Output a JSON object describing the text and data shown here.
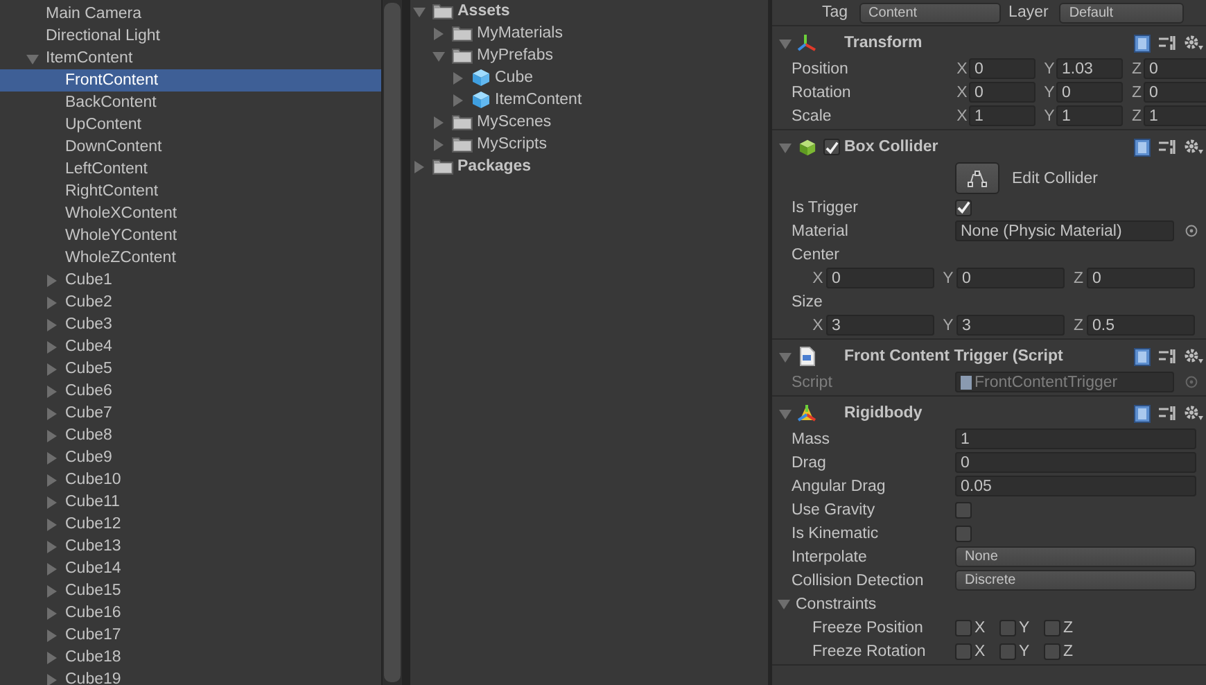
{
  "hierarchy": {
    "items": [
      {
        "name": "Main Camera",
        "selected": false
      },
      {
        "name": "Directional Light",
        "selected": false
      },
      {
        "name": "ItemContent",
        "selected": false,
        "expanded": true,
        "children": [
          {
            "name": "FrontContent",
            "selected": true
          },
          {
            "name": "BackContent",
            "selected": false
          },
          {
            "name": "UpContent",
            "selected": false
          },
          {
            "name": "DownContent",
            "selected": false
          },
          {
            "name": "LeftContent",
            "selected": false
          },
          {
            "name": "RightContent",
            "selected": false
          },
          {
            "name": "WholeXContent",
            "selected": false
          },
          {
            "name": "WholeYContent",
            "selected": false
          },
          {
            "name": "WholeZContent",
            "selected": false
          },
          {
            "name": "Cube1",
            "selected": false,
            "expanded": false
          },
          {
            "name": "Cube2",
            "selected": false,
            "expanded": false
          },
          {
            "name": "Cube3",
            "selected": false,
            "expanded": false
          },
          {
            "name": "Cube4",
            "selected": false,
            "expanded": false
          },
          {
            "name": "Cube5",
            "selected": false,
            "expanded": false
          },
          {
            "name": "Cube6",
            "selected": false,
            "expanded": false
          },
          {
            "name": "Cube7",
            "selected": false,
            "expanded": false
          },
          {
            "name": "Cube8",
            "selected": false,
            "expanded": false
          },
          {
            "name": "Cube9",
            "selected": false,
            "expanded": false
          },
          {
            "name": "Cube10",
            "selected": false,
            "expanded": false
          },
          {
            "name": "Cube11",
            "selected": false,
            "expanded": false
          },
          {
            "name": "Cube12",
            "selected": false,
            "expanded": false
          },
          {
            "name": "Cube13",
            "selected": false,
            "expanded": false
          },
          {
            "name": "Cube14",
            "selected": false,
            "expanded": false
          },
          {
            "name": "Cube15",
            "selected": false,
            "expanded": false
          },
          {
            "name": "Cube16",
            "selected": false,
            "expanded": false
          },
          {
            "name": "Cube17",
            "selected": false,
            "expanded": false
          },
          {
            "name": "Cube18",
            "selected": false,
            "expanded": false
          },
          {
            "name": "Cube19",
            "selected": false,
            "expanded": false
          }
        ]
      }
    ]
  },
  "project": {
    "items": [
      {
        "name": "Assets",
        "kind": "root",
        "expanded": true,
        "children": [
          {
            "name": "MyMaterials",
            "kind": "folder",
            "expanded": false
          },
          {
            "name": "MyPrefabs",
            "kind": "folder",
            "expanded": true,
            "children": [
              {
                "name": "Cube",
                "kind": "prefab",
                "expanded": false
              },
              {
                "name": "ItemContent",
                "kind": "prefab",
                "expanded": false
              }
            ]
          },
          {
            "name": "MyScenes",
            "kind": "folder",
            "expanded": false
          },
          {
            "name": "MyScripts",
            "kind": "folder",
            "expanded": false
          }
        ]
      },
      {
        "name": "Packages",
        "kind": "root",
        "expanded": false
      }
    ]
  },
  "inspector": {
    "tag_label": "Tag",
    "tag": "Content",
    "layer_label": "Layer",
    "layer": "Default",
    "components": [
      {
        "title": "Transform",
        "kind": "transform",
        "expanded": true,
        "rows": [
          {
            "kind": "vector",
            "label": "Position",
            "axes": [
              {
                "axis": "X",
                "value": "0"
              },
              {
                "axis": "Y",
                "value": "1.03"
              },
              {
                "axis": "Z",
                "value": "0"
              }
            ]
          },
          {
            "kind": "vector",
            "label": "Rotation",
            "axes": [
              {
                "axis": "X",
                "value": "0"
              },
              {
                "axis": "Y",
                "value": "0"
              },
              {
                "axis": "Z",
                "value": "0"
              }
            ]
          },
          {
            "kind": "vector",
            "label": "Scale",
            "axes": [
              {
                "axis": "X",
                "value": "1"
              },
              {
                "axis": "Y",
                "value": "1"
              },
              {
                "axis": "Z",
                "value": "1"
              }
            ]
          }
        ]
      },
      {
        "title": "Box Collider",
        "kind": "collider",
        "expanded": true,
        "enabled": true,
        "rows": [
          {
            "kind": "tool",
            "label": "Edit Collider"
          },
          {
            "kind": "toggle",
            "label": "Is Trigger",
            "checked": true
          },
          {
            "kind": "object",
            "label": "Material",
            "value": "None (Physic Material)"
          },
          {
            "kind": "vector_block",
            "label": "Center",
            "axes": [
              {
                "axis": "X",
                "value": "0"
              },
              {
                "axis": "Y",
                "value": "0"
              },
              {
                "axis": "Z",
                "value": "0"
              }
            ]
          },
          {
            "kind": "vector_block",
            "label": "Size",
            "axes": [
              {
                "axis": "X",
                "value": "3"
              },
              {
                "axis": "Y",
                "value": "3"
              },
              {
                "axis": "Z",
                "value": "0.5"
              }
            ]
          }
        ]
      },
      {
        "title": "Front Content Trigger (Script",
        "kind": "script",
        "expanded": true,
        "rows": [
          {
            "kind": "script",
            "label": "Script",
            "value": "FrontContentTrigger"
          }
        ]
      },
      {
        "title": "Rigidbody",
        "kind": "rigidbody",
        "expanded": true,
        "rows": [
          {
            "kind": "field",
            "label": "Mass",
            "value": "1"
          },
          {
            "kind": "field",
            "label": "Drag",
            "value": "0"
          },
          {
            "kind": "field",
            "label": "Angular Drag",
            "value": "0.05"
          },
          {
            "kind": "toggle",
            "label": "Use Gravity",
            "checked": false
          },
          {
            "kind": "toggle",
            "label": "Is Kinematic",
            "checked": false
          },
          {
            "kind": "dropdown",
            "label": "Interpolate",
            "value": "None"
          },
          {
            "kind": "dropdown",
            "label": "Collision Detection",
            "value": "Discrete"
          },
          {
            "kind": "foldout",
            "label": "Constraints",
            "expanded": true
          },
          {
            "kind": "axis_toggles",
            "label": "Freeze Position",
            "axes": [
              {
                "axis": "X",
                "checked": false
              },
              {
                "axis": "Y",
                "checked": false
              },
              {
                "axis": "Z",
                "checked": false
              }
            ]
          },
          {
            "kind": "axis_toggles",
            "label": "Freeze Rotation",
            "axes": [
              {
                "axis": "X",
                "checked": false
              },
              {
                "axis": "Y",
                "checked": false
              },
              {
                "axis": "Z",
                "checked": false
              }
            ]
          }
        ]
      }
    ]
  }
}
